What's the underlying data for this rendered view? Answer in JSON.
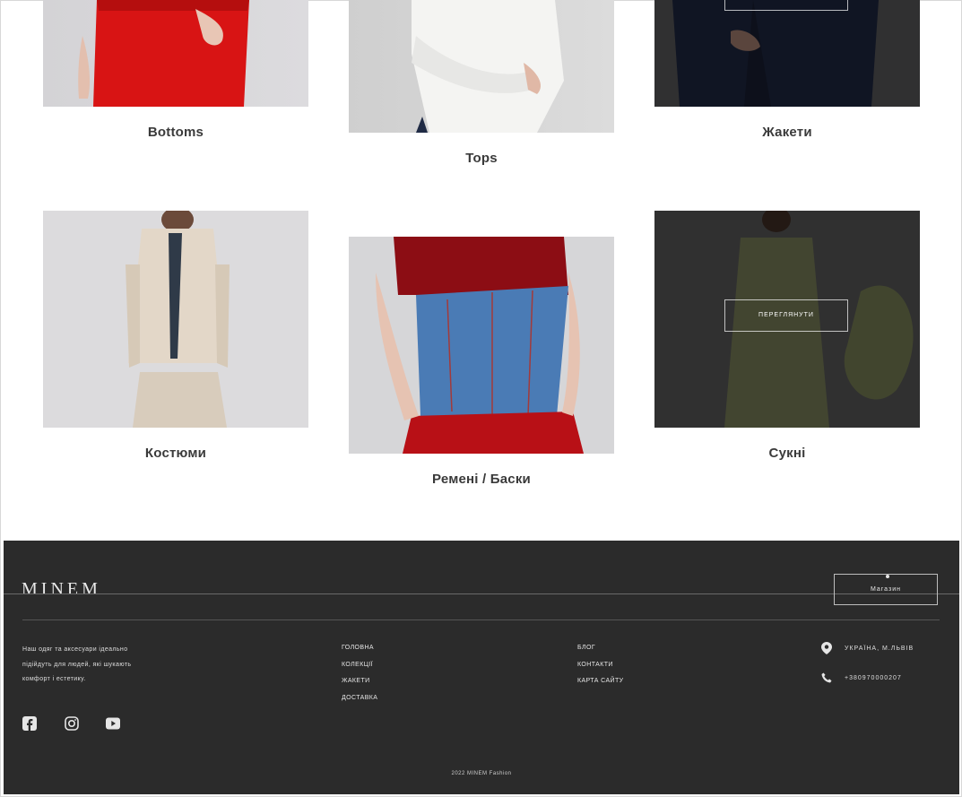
{
  "categories": [
    {
      "label": "Bottoms"
    },
    {
      "label": "Tops"
    },
    {
      "label": "Жакети"
    },
    {
      "label": "Костюми"
    },
    {
      "label": "Ремені / Баски"
    },
    {
      "label": "Сукні"
    }
  ],
  "overlay": {
    "button_label": "Переглянути"
  },
  "footer": {
    "logo": "MINEM",
    "shop_button": "Магазин",
    "about": "Наш одяг та аксесуари ідеально підійдуть для людей, які шукають комфорт і естетику.",
    "links_col1": [
      "Головна",
      "Колекції",
      "Жакети",
      "Доставка"
    ],
    "links_col2": [
      "Блог",
      "Контакти",
      "Карта сайту"
    ],
    "contact_location": "Україна, м.Львів",
    "contact_phone": "+380970000207",
    "social": [
      "facebook-icon",
      "instagram-icon",
      "youtube-icon"
    ],
    "copyright": "2022 MINEM Fashion",
    "colors": {
      "footer_bg": "#2b2b2b",
      "text": "#e6e6e6"
    }
  }
}
